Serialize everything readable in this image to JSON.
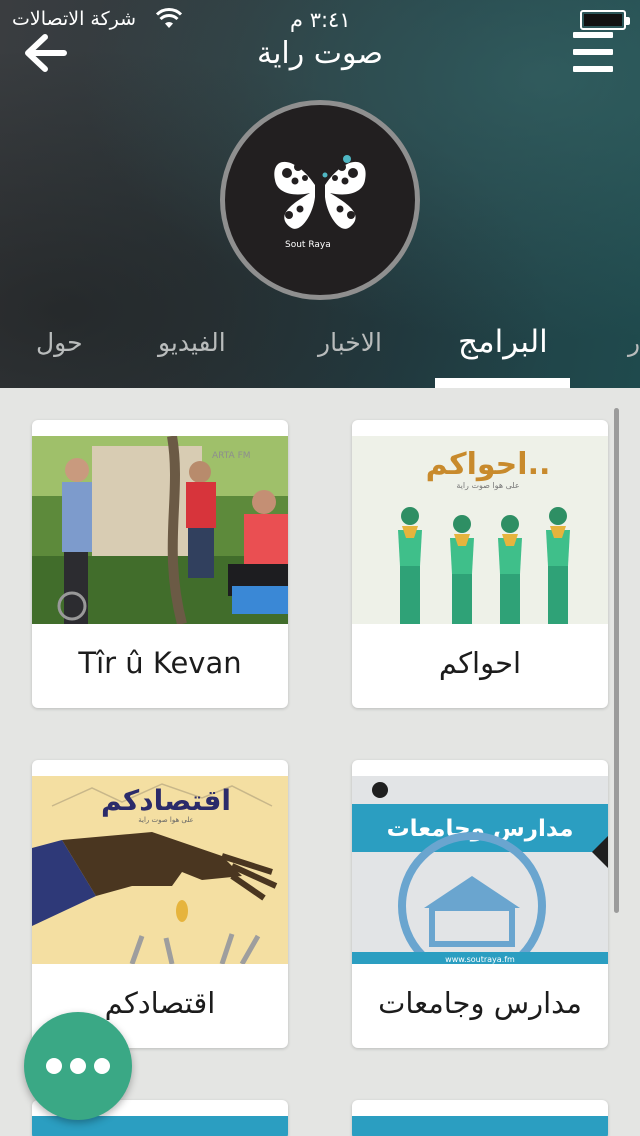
{
  "status_bar": {
    "carrier": "شركة الاتصالات",
    "time": "٣:٤١ م"
  },
  "header": {
    "title": "صوت راية",
    "logo_text": "Sout Raya"
  },
  "tabs": [
    {
      "label": "حول",
      "active": false
    },
    {
      "label": "الفيديو",
      "active": false
    },
    {
      "label": "الاخبار",
      "active": false
    },
    {
      "label": "البرامج",
      "active": true
    },
    {
      "label": "ر",
      "active": false
    }
  ],
  "programs": [
    {
      "title": "احواكم",
      "thumb_text": "احواكم..",
      "thumb_sub": "على هوا صوت راية"
    },
    {
      "title": "Tîr û Kevan",
      "thumb_text": "ARTA FM"
    },
    {
      "title": "مدارس وجامعات",
      "thumb_text": "مدارس وجامعات",
      "thumb_sub": "www.soutraya.fm"
    },
    {
      "title": "اقتصادكم",
      "thumb_text": "اقتصادكم",
      "thumb_sub": "على هوا صوت راية"
    }
  ],
  "colors": {
    "accent": "#3aa885",
    "teal_banner": "#2b9ec1",
    "background": "#e4e5e3"
  },
  "icons": {
    "back": "arrow-left-icon",
    "menu": "hamburger-menu-icon",
    "fab": "more-dots-icon"
  }
}
